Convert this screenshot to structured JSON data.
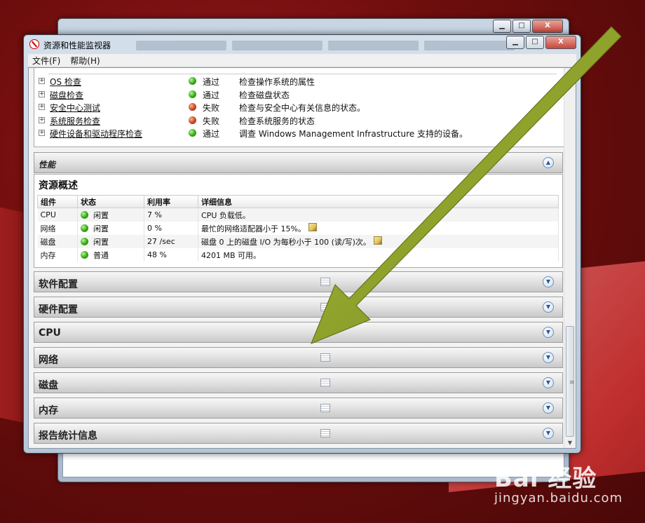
{
  "background_window": {
    "caption": {
      "min": "▁",
      "max": "□",
      "close": "X"
    }
  },
  "window": {
    "title": "资源和性能监视器",
    "caption": {
      "min": "▁",
      "max": "□",
      "close": "X"
    }
  },
  "menu": {
    "items": [
      "文件(F)",
      "帮助(H)"
    ]
  },
  "diagnostics": {
    "rows": [
      {
        "name": "OS 检查",
        "status": "ok",
        "result": "通过",
        "desc": "检查操作系统的属性"
      },
      {
        "name": "磁盘检查",
        "status": "ok",
        "result": "通过",
        "desc": "检查磁盘状态"
      },
      {
        "name": "安全中心测试",
        "status": "fail",
        "result": "失败",
        "desc": "检查与安全中心有关信息的状态。"
      },
      {
        "name": "系统服务检查",
        "status": "fail",
        "result": "失败",
        "desc": "检查系统服务的状态"
      },
      {
        "name": "硬件设备和驱动程序检查",
        "status": "ok",
        "result": "通过",
        "desc": "调查 Windows Management Infrastructure 支持的设备。"
      }
    ]
  },
  "performance_section": {
    "label": "性能"
  },
  "resource_overview": {
    "title": "资源概述",
    "headers": [
      "组件",
      "状态",
      "利用率",
      "详细信息"
    ],
    "rows": [
      {
        "component": "CPU",
        "state": "闲置",
        "usage": "7 %",
        "detail": "CPU 负载低。",
        "edit": false
      },
      {
        "component": "网络",
        "state": "闲置",
        "usage": "0 %",
        "detail": "最忙的网络适配器小于 15%。",
        "edit": true
      },
      {
        "component": "磁盘",
        "state": "闲置",
        "usage": "27 /sec",
        "detail": "磁盘 0 上的磁盘 I/O 为每秒小于 100 (读/写)次。",
        "edit": true
      },
      {
        "component": "内存",
        "state": "普通",
        "usage": "48 %",
        "detail": "4201 MB 可用。",
        "edit": false
      }
    ]
  },
  "sections": [
    {
      "label": "软件配置",
      "icon": true
    },
    {
      "label": "硬件配置",
      "icon": true
    },
    {
      "label": "CPU",
      "icon": false
    },
    {
      "label": "网络",
      "icon": true
    },
    {
      "label": "磁盘",
      "icon": true
    },
    {
      "label": "内存",
      "icon": true
    },
    {
      "label": "报告统计信息",
      "icon": true
    }
  ],
  "watermark": {
    "logo": "Bai 经验",
    "sub": "jingyan.baidu.com"
  },
  "colors": {
    "arrow": "#8ea02a",
    "ok": "#3bb01a",
    "fail": "#c8461e"
  }
}
